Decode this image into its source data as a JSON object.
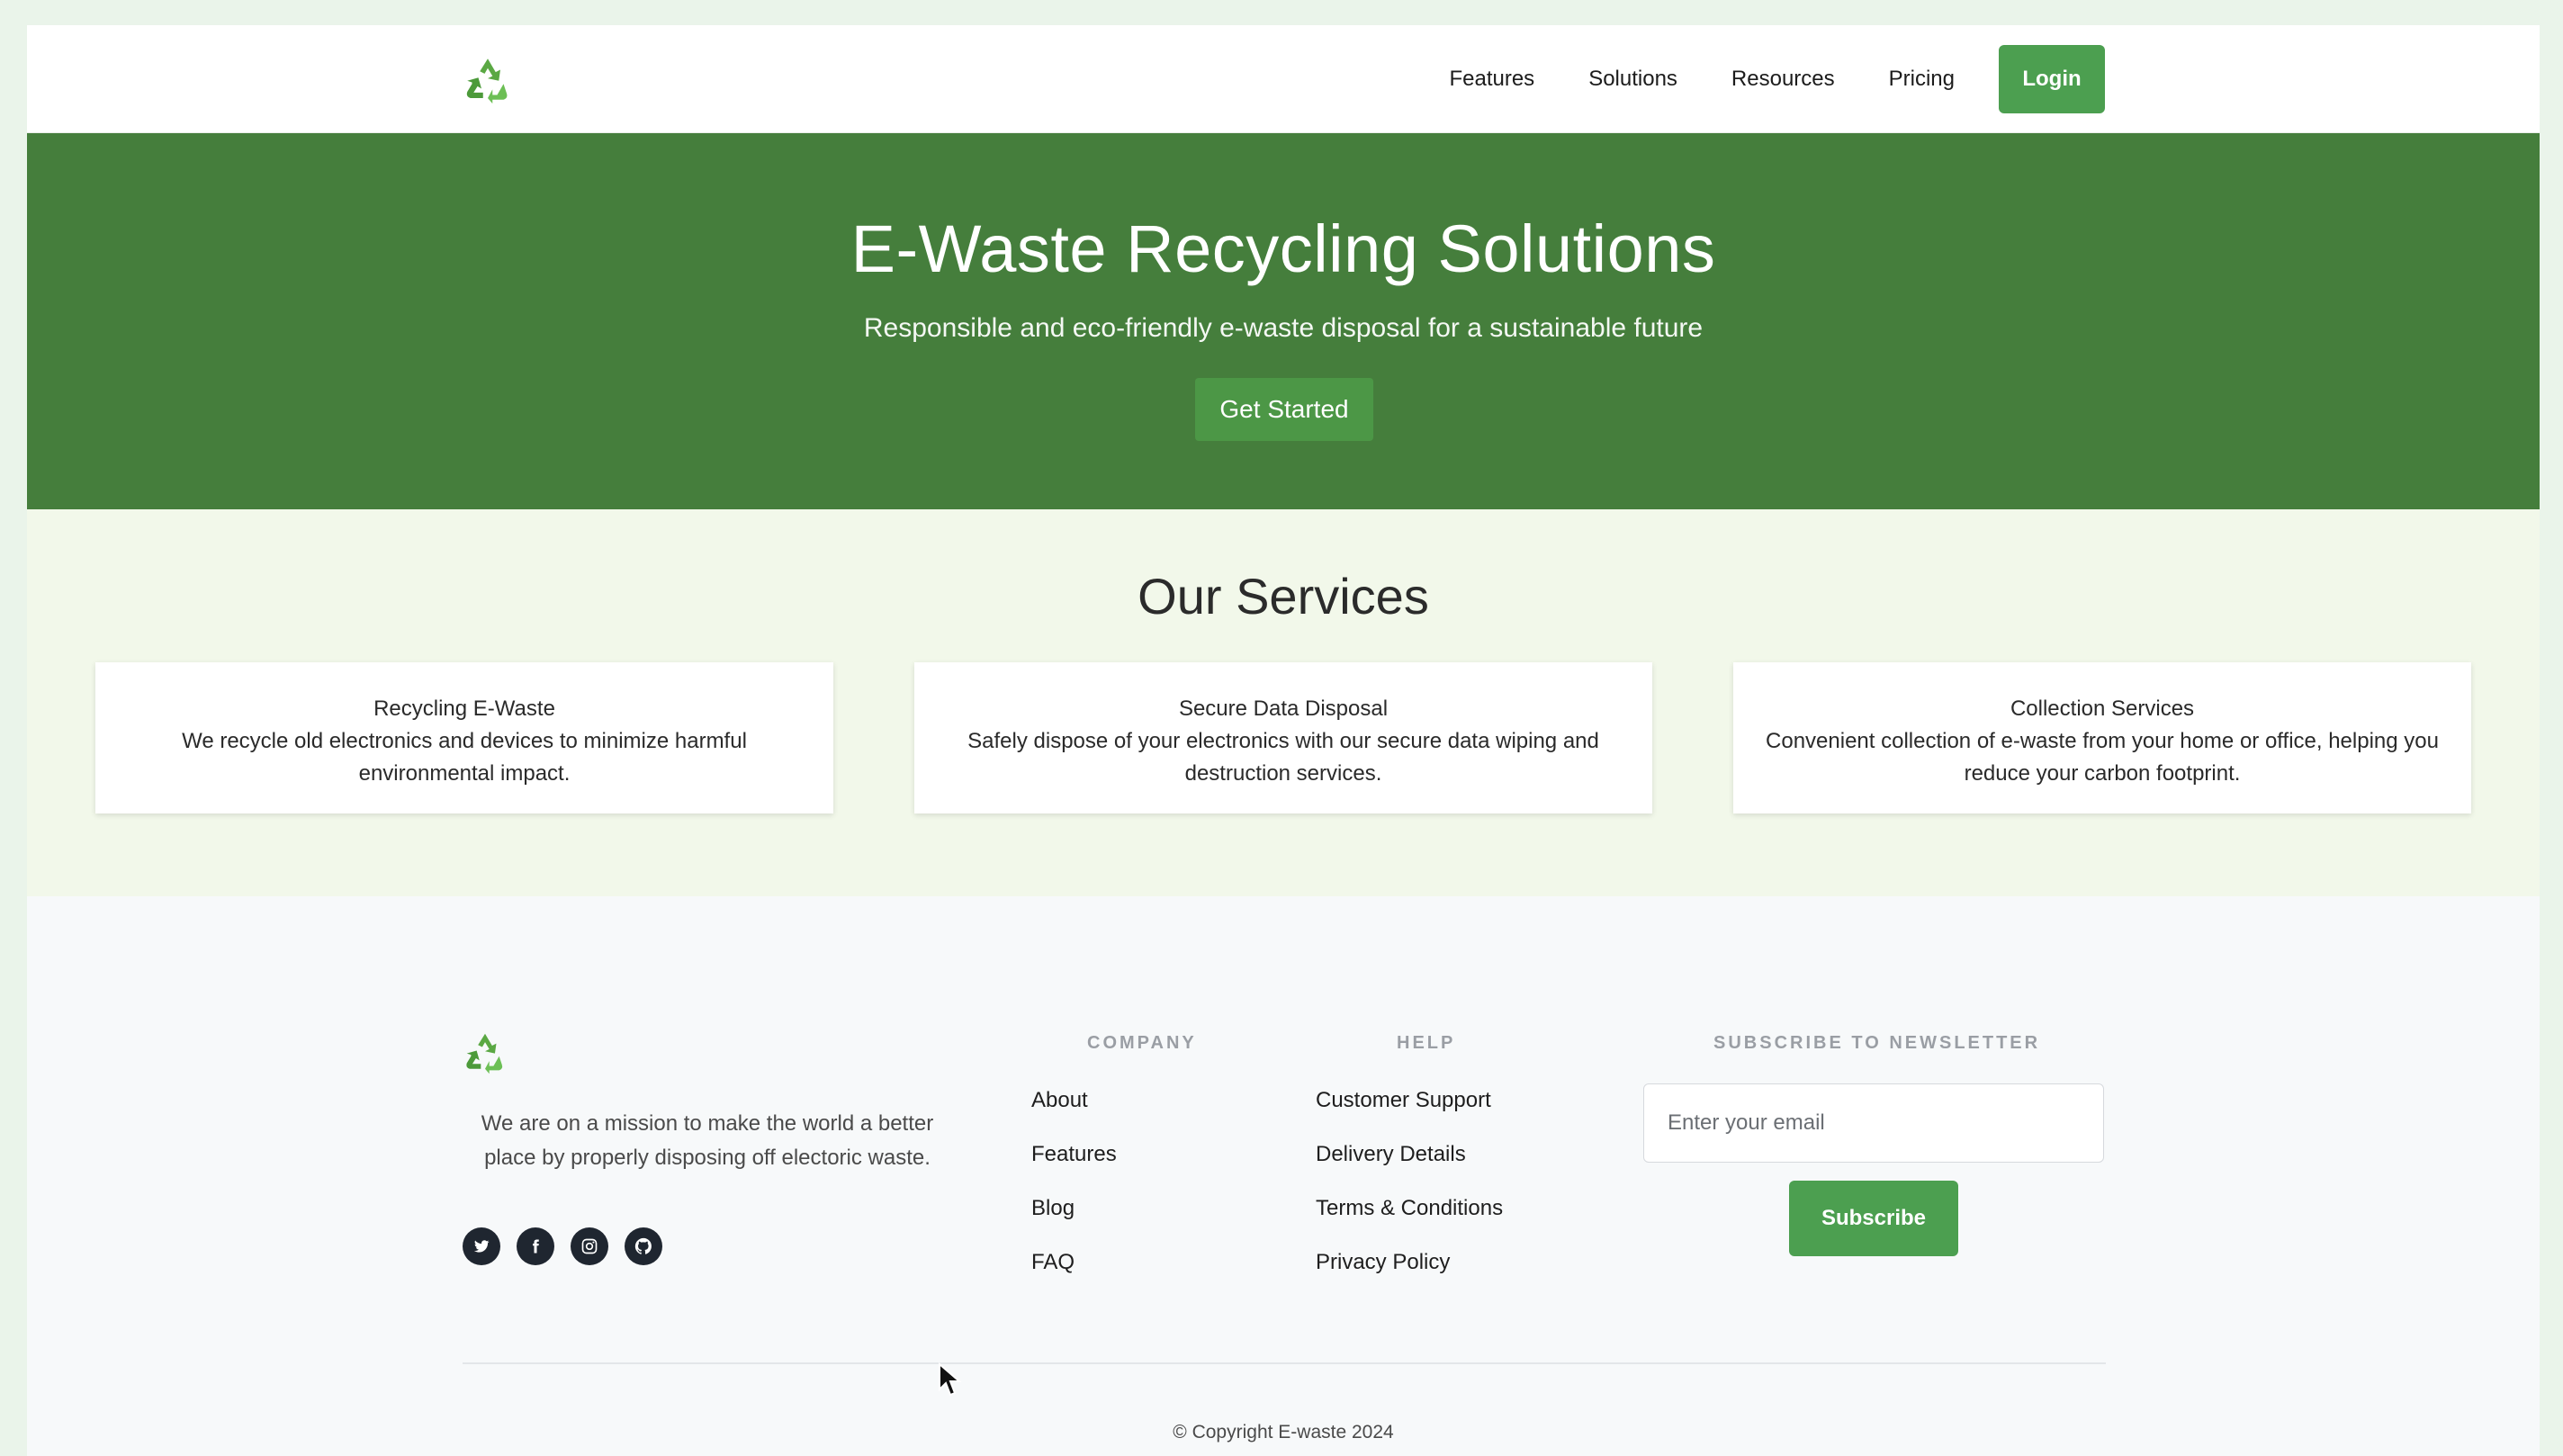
{
  "nav": {
    "logo_icon": "recycle-icon",
    "links": [
      "Features",
      "Solutions",
      "Resources",
      "Pricing"
    ],
    "login_label": "Login"
  },
  "hero": {
    "title": "E-Waste Recycling Solutions",
    "subtitle": "Responsible and eco-friendly e-waste disposal for a sustainable future",
    "cta_label": "Get Started"
  },
  "services": {
    "title": "Our Services",
    "cards": [
      {
        "title": "Recycling E-Waste",
        "desc": "We recycle old electronics and devices to minimize harmful environmental impact."
      },
      {
        "title": "Secure Data Disposal",
        "desc": "Safely dispose of your electronics with our secure data wiping and destruction services."
      },
      {
        "title": "Collection Services",
        "desc": "Convenient collection of e-waste from your home or office, helping you reduce your carbon footprint."
      }
    ]
  },
  "footer": {
    "mission": "We are on a mission to make the world a better place by properly disposing off electoric waste.",
    "socials": [
      "twitter-icon",
      "facebook-icon",
      "instagram-icon",
      "github-icon"
    ],
    "company": {
      "heading": "COMPANY",
      "links": [
        "About",
        "Features",
        "Blog",
        "FAQ"
      ]
    },
    "help": {
      "heading": "HELP",
      "links": [
        "Customer Support",
        "Delivery Details",
        "Terms & Conditions",
        "Privacy Policy"
      ]
    },
    "newsletter": {
      "heading": "SUBSCRIBE TO NEWSLETTER",
      "placeholder": "Enter your email",
      "button_label": "Subscribe"
    },
    "copyright": "© Copyright E-waste 2024"
  },
  "colors": {
    "brand_green": "#4c9f50",
    "hero_bg": "#457e3c",
    "services_bg": "#f2f8ea",
    "footer_bg": "#f7f9fa",
    "page_bg": "#eaf4ea"
  }
}
